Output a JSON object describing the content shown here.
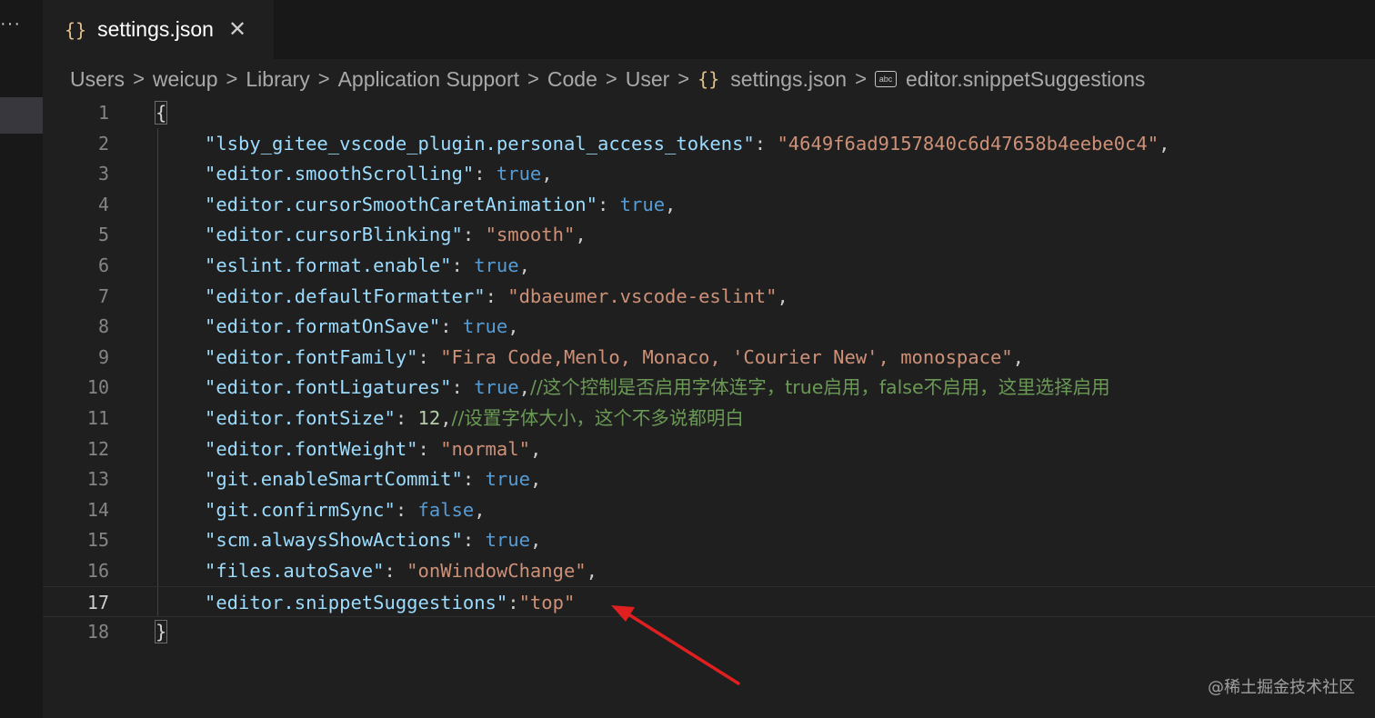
{
  "sidebar": {
    "more_label": "···"
  },
  "tab": {
    "icon": "{}",
    "title": "settings.json",
    "close_glyph": "✕"
  },
  "breadcrumb": {
    "items": [
      "Users",
      "weicup",
      "Library",
      "Application Support",
      "Code",
      "User"
    ],
    "file_icon": "{}",
    "file": "settings.json",
    "symbol_icon_text": "abc",
    "symbol": "editor.snippetSuggestions",
    "separator": ">"
  },
  "editor": {
    "line_numbers": [
      "1",
      "2",
      "3",
      "4",
      "5",
      "6",
      "7",
      "8",
      "9",
      "10",
      "11",
      "12",
      "13",
      "14",
      "15",
      "16",
      "17",
      "18"
    ],
    "current_line": 17,
    "lines": [
      [
        [
          "p",
          "{"
        ]
      ],
      [
        [
          "k",
          "\"lsby_gitee_vscode_plugin.personal_access_tokens\""
        ],
        [
          "p",
          ": "
        ],
        [
          "s",
          "\"4649f6ad9157840c6d47658b4eebe0c4\""
        ],
        [
          "p",
          ","
        ]
      ],
      [
        [
          "k",
          "\"editor.smoothScrolling\""
        ],
        [
          "p",
          ": "
        ],
        [
          "b",
          "true"
        ],
        [
          "p",
          ","
        ]
      ],
      [
        [
          "k",
          "\"editor.cursorSmoothCaretAnimation\""
        ],
        [
          "p",
          ": "
        ],
        [
          "b",
          "true"
        ],
        [
          "p",
          ","
        ]
      ],
      [
        [
          "k",
          "\"editor.cursorBlinking\""
        ],
        [
          "p",
          ": "
        ],
        [
          "s",
          "\"smooth\""
        ],
        [
          "p",
          ","
        ]
      ],
      [
        [
          "k",
          "\"eslint.format.enable\""
        ],
        [
          "p",
          ": "
        ],
        [
          "b",
          "true"
        ],
        [
          "p",
          ","
        ]
      ],
      [
        [
          "k",
          "\"editor.defaultFormatter\""
        ],
        [
          "p",
          ": "
        ],
        [
          "s",
          "\"dbaeumer.vscode-eslint\""
        ],
        [
          "p",
          ","
        ]
      ],
      [
        [
          "k",
          "\"editor.formatOnSave\""
        ],
        [
          "p",
          ": "
        ],
        [
          "b",
          "true"
        ],
        [
          "p",
          ","
        ]
      ],
      [
        [
          "k",
          "\"editor.fontFamily\""
        ],
        [
          "p",
          ": "
        ],
        [
          "s",
          "\"Fira Code,Menlo, Monaco, 'Courier New', monospace\""
        ],
        [
          "p",
          ","
        ]
      ],
      [
        [
          "k",
          "\"editor.fontLigatures\""
        ],
        [
          "p",
          ": "
        ],
        [
          "b",
          "true"
        ],
        [
          "p",
          ","
        ],
        [
          "c",
          "//这个控制是否启用字体连字，true启用，false不启用，这里选择启用"
        ]
      ],
      [
        [
          "k",
          "\"editor.fontSize\""
        ],
        [
          "p",
          ": "
        ],
        [
          "n",
          "12"
        ],
        [
          "p",
          ","
        ],
        [
          "c",
          "//设置字体大小，这个不多说都明白"
        ]
      ],
      [
        [
          "k",
          "\"editor.fontWeight\""
        ],
        [
          "p",
          ": "
        ],
        [
          "s",
          "\"normal\""
        ],
        [
          "p",
          ","
        ]
      ],
      [
        [
          "k",
          "\"git.enableSmartCommit\""
        ],
        [
          "p",
          ": "
        ],
        [
          "b",
          "true"
        ],
        [
          "p",
          ","
        ]
      ],
      [
        [
          "k",
          "\"git.confirmSync\""
        ],
        [
          "p",
          ": "
        ],
        [
          "b",
          "false"
        ],
        [
          "p",
          ","
        ]
      ],
      [
        [
          "k",
          "\"scm.alwaysShowActions\""
        ],
        [
          "p",
          ": "
        ],
        [
          "b",
          "true"
        ],
        [
          "p",
          ","
        ]
      ],
      [
        [
          "k",
          "\"files.autoSave\""
        ],
        [
          "p",
          ": "
        ],
        [
          "s",
          "\"onWindowChange\""
        ],
        [
          "p",
          ","
        ]
      ],
      [
        [
          "k",
          "\"editor.snippetSuggestions\""
        ],
        [
          "p",
          ":"
        ],
        [
          "s",
          "\"top\""
        ]
      ],
      [
        [
          "p",
          "}"
        ]
      ]
    ]
  },
  "watermark": "@稀土掘金技术社区",
  "colors": {
    "background": "#1f1f1f",
    "key": "#9cdcfe",
    "string": "#ce9178",
    "boolean": "#569cd6",
    "comment": "#6a9955",
    "arrow": "#e02020"
  }
}
